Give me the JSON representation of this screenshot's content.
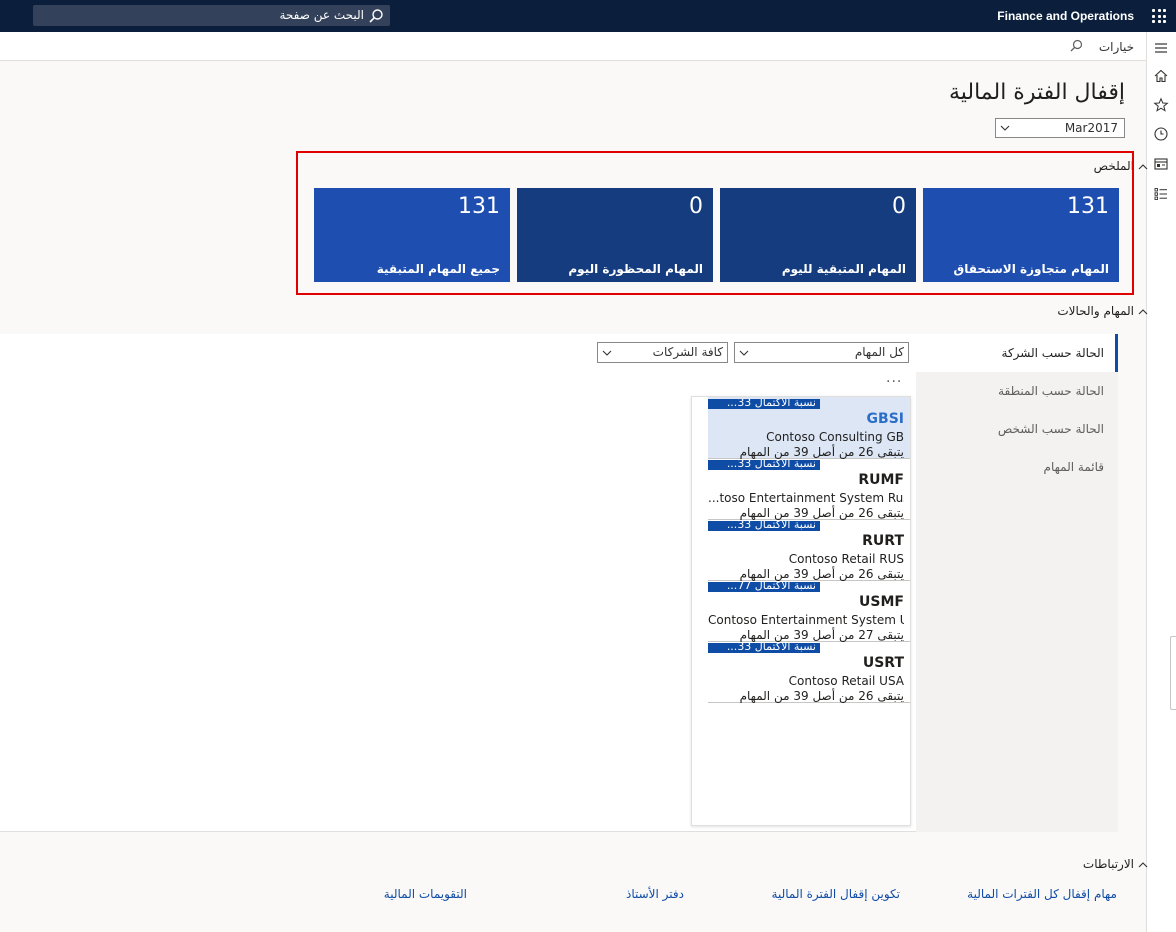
{
  "app": {
    "title": "Finance and Operations"
  },
  "search": {
    "placeholder": "البحث عن صفحة"
  },
  "actionbar": {
    "options_label": "خيارات"
  },
  "page": {
    "title": "إقفال الفترة المالية",
    "period_value": "Mar2017"
  },
  "summary": {
    "header": "الملخص",
    "tiles": [
      {
        "count": "131",
        "label": "المهام متجاوزة الاستحقاق",
        "color": "#1e4fb0"
      },
      {
        "count": "0",
        "label": "المهام المتبقية لليوم",
        "color": "#153c7e"
      },
      {
        "count": "0",
        "label": "المهام المحظورة اليوم",
        "color": "#153c7e"
      },
      {
        "count": "131",
        "label": "جميع المهام المتبقية",
        "color": "#1e4fb0"
      }
    ]
  },
  "tasks_section": {
    "header": "المهام والحالات",
    "tabs": [
      "الحالة حسب الشركة",
      "الحالة حسب المنطقة",
      "الحالة حسب الشخص",
      "قائمة المهام"
    ],
    "filter_tasks": "كل المهام",
    "filter_companies": "كافة الشركات",
    "more": "...",
    "items": [
      {
        "progress_label": "نسبة الاكتمال 33...",
        "progress": 0.33,
        "code": "GBSI",
        "name": "Contoso Consulting GB",
        "remaining": "يتبقى 26 من أصل 39 من المهام"
      },
      {
        "progress_label": "نسبة الاكتمال 33...",
        "progress": 0.33,
        "code": "RUMF",
        "name": "...toso Entertainment System Russia",
        "remaining": "يتبقى 26 من أصل 39 من المهام"
      },
      {
        "progress_label": "نسبة الاكتمال 33...",
        "progress": 0.33,
        "code": "RURT",
        "name": "Contoso Retail RUS",
        "remaining": "يتبقى 26 من أصل 39 من المهام"
      },
      {
        "progress_label": "نسبة الاكتمال 77...",
        "progress": 0.31,
        "code": "USMF",
        "name": "Contoso Entertainment System USA",
        "remaining": "يتبقى 27 من أصل 39 من المهام"
      },
      {
        "progress_label": "نسبة الاكتمال 33...",
        "progress": 0.33,
        "code": "USRT",
        "name": "Contoso Retail USA",
        "remaining": "يتبقى 26 من أصل 39 من المهام"
      }
    ]
  },
  "links_section": {
    "header": "الارتباطات",
    "links": [
      "مهام إقفال كل الفترات المالية",
      "تكوين إقفال الفترة المالية",
      "دفتر الأستاذ",
      "التقويمات المالية"
    ]
  },
  "colors": {
    "accent": "#0f4ca6",
    "topbar": "#0b1f3d",
    "highlight_frame": "#e00000"
  }
}
